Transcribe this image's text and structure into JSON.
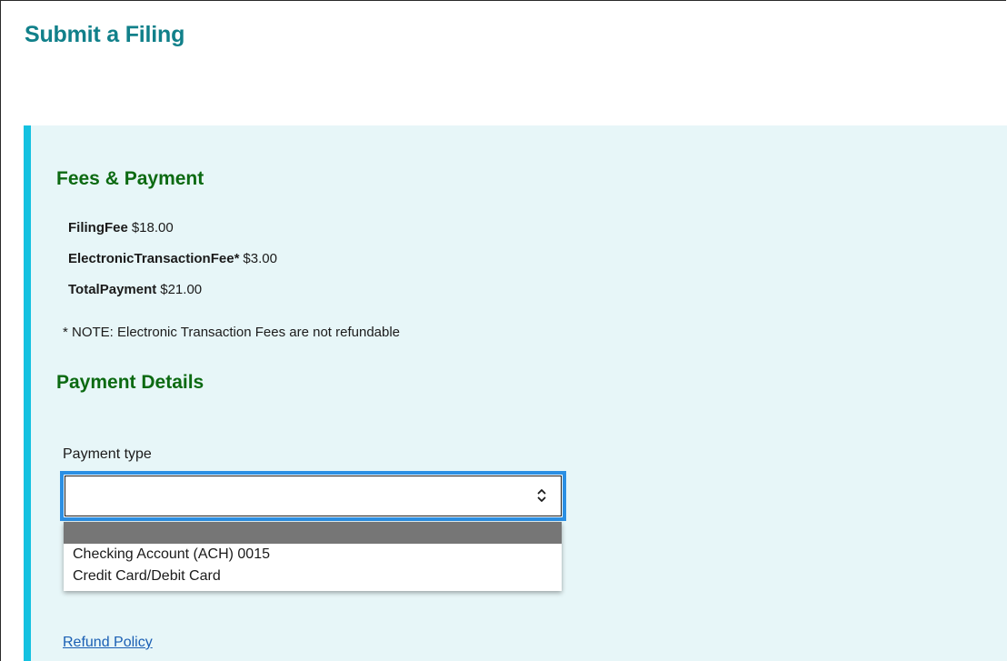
{
  "page": {
    "title": "Submit a Filing"
  },
  "fees": {
    "heading": "Fees & Payment",
    "rows": [
      {
        "label": "FilingFee",
        "value": "$18.00"
      },
      {
        "label": "ElectronicTransactionFee*",
        "value": "$3.00"
      },
      {
        "label": "TotalPayment",
        "value": "$21.00"
      }
    ],
    "note": "* NOTE: Electronic Transaction Fees are not refundable"
  },
  "payment": {
    "heading": "Payment Details",
    "type_label": "Payment type",
    "selected_value": "",
    "options": [
      "",
      "Checking Account (ACH) 0015",
      "Credit Card/Debit Card"
    ],
    "icon": "chevron-up-down-icon"
  },
  "links": {
    "refund_policy": "Refund Policy"
  },
  "colors": {
    "title": "#11808a",
    "section_heading": "#0c6a12",
    "panel_background": "#e7f6f8",
    "panel_accent": "#14c1e0",
    "focus_ring": "#2b8fe3",
    "option_highlight": "#767676",
    "link": "#1a5fb4"
  }
}
